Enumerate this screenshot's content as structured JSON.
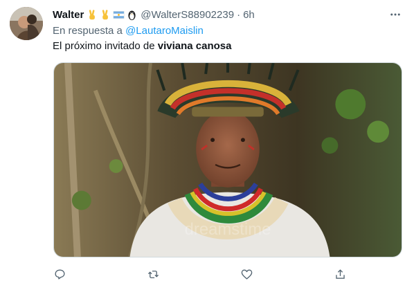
{
  "tweet": {
    "author_name": "Walter",
    "author_emojis": [
      "victory-hand",
      "victory-hand",
      "argentina-flag",
      "penguin"
    ],
    "handle": "@WalterS88902239",
    "separator": "·",
    "time": "6h",
    "reply_prefix": "En respuesta a",
    "reply_mention": "@LautaroMaislin",
    "text_prefix": "El próximo invitado de",
    "text_bold": "viviana canosa",
    "media": {
      "description_icon": "photo",
      "watermark": "dreamstime"
    },
    "actions": [
      {
        "name": "reply",
        "icon": "reply-icon"
      },
      {
        "name": "retweet",
        "icon": "retweet-icon"
      },
      {
        "name": "like",
        "icon": "heart-icon"
      },
      {
        "name": "share",
        "icon": "share-icon"
      }
    ]
  },
  "colors": {
    "text": "#0f1419",
    "muted": "#536471",
    "link": "#1d9bf0",
    "border": "#cfd9de"
  }
}
